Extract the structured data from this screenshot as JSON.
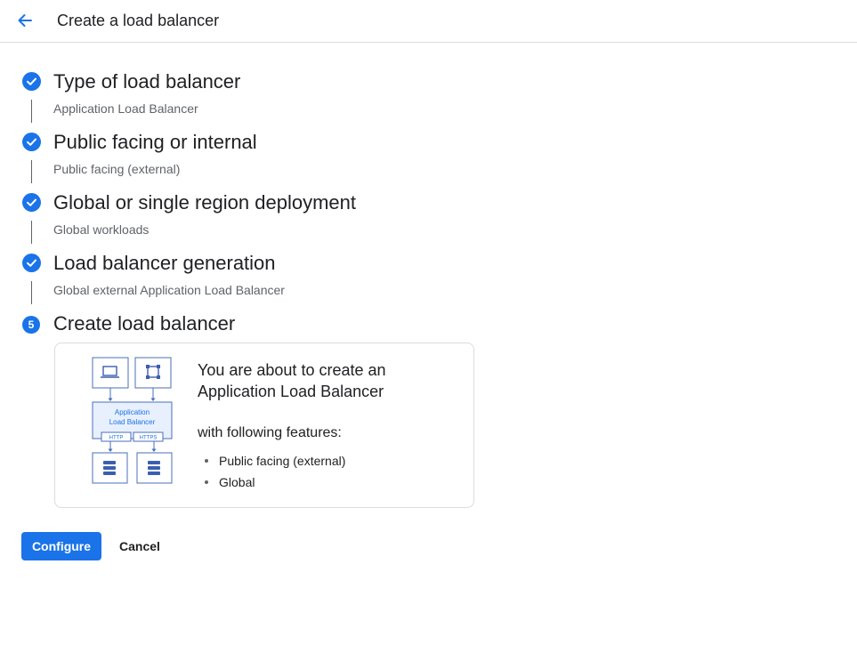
{
  "header": {
    "title": "Create a load balancer",
    "back_icon": "arrow-back-icon"
  },
  "colors": {
    "accent": "#1a73e8",
    "text_primary": "#202124",
    "text_secondary": "#5f6368",
    "border": "#dadce0"
  },
  "steps": [
    {
      "status": "complete",
      "icon": "check-circle-icon",
      "title": "Type of load balancer",
      "value": "Application Load Balancer"
    },
    {
      "status": "complete",
      "icon": "check-circle-icon",
      "title": "Public facing or internal",
      "value": "Public facing (external)"
    },
    {
      "status": "complete",
      "icon": "check-circle-icon",
      "title": "Global or single region deployment",
      "value": "Global workloads"
    },
    {
      "status": "complete",
      "icon": "check-circle-icon",
      "title": "Load balancer generation",
      "value": "Global external Application Load Balancer"
    },
    {
      "status": "current",
      "number": "5",
      "title": "Create load balancer"
    }
  ],
  "summary": {
    "heading": "You are about to create an Application Load Balancer",
    "features_label": "with following features:",
    "features": [
      "Public facing (external)",
      "Global"
    ],
    "diagram": {
      "top_icons": [
        "laptop-icon",
        "network-icon"
      ],
      "center_label": "Application Load Balancer",
      "protocols": [
        "HTTP",
        "HTTPS"
      ],
      "bottom_icons": [
        "database-icon",
        "database-icon"
      ]
    }
  },
  "actions": {
    "configure_label": "Configure",
    "cancel_label": "Cancel"
  }
}
